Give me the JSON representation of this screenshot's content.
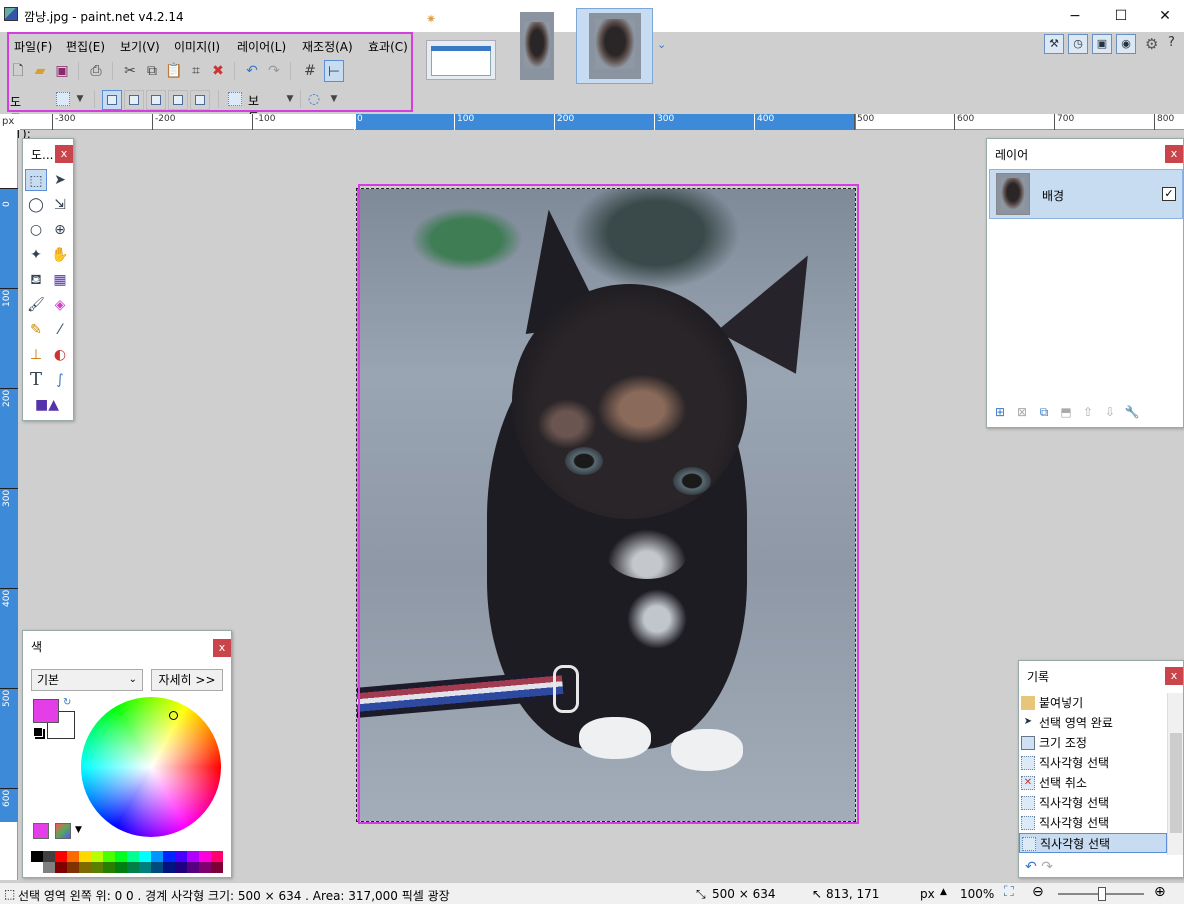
{
  "window": {
    "title": "깜냥.jpg - paint.net v4.2.14",
    "minimize": "−",
    "maximize": "☐",
    "close": "✕"
  },
  "menu": [
    "파일(F)",
    "편집(E)",
    "보기(V)",
    "이미지(I)",
    "레이어(L)",
    "재조정(A)",
    "효과(C)"
  ],
  "toolbar": {
    "tool_label": "도구(T):",
    "blend_mode": "보통"
  },
  "ruler": {
    "unit": "px",
    "h_ticks": [
      "-300",
      "-200",
      "-100",
      "0",
      "100",
      "200",
      "300",
      "400",
      "500",
      "600",
      "700",
      "800"
    ],
    "v_ticks": [
      "0",
      "100",
      "200",
      "300",
      "400",
      "500",
      "600"
    ]
  },
  "tools_panel": {
    "title": "도...",
    "close": "x"
  },
  "layers_panel": {
    "title": "레이어",
    "close": "x",
    "layers": [
      {
        "name": "배경",
        "visible": true
      }
    ]
  },
  "colors_panel": {
    "title": "색",
    "close": "x",
    "palette_select": "기본",
    "more_button": "자세히 >>",
    "primary_color": "#e43ee8",
    "secondary_color": "#ffffff"
  },
  "history_panel": {
    "title": "기록",
    "close": "x",
    "items": [
      "붙여넣기",
      "선택 영역 완료",
      "크기 조정",
      "직사각형 선택",
      "선택 취소",
      "직사각형 선택",
      "직사각형 선택",
      "직사각형 선택"
    ],
    "active_index": 7
  },
  "statusbar": {
    "selection_info": "선택 영역 왼쪽 위: 0  0 . 경계 사각형 크기: 500  × 634 . Area: 317,000 픽셀 광장",
    "image_size": "500 × 634",
    "cursor_pos": "813, 171",
    "unit": "px",
    "zoom": "100%"
  }
}
